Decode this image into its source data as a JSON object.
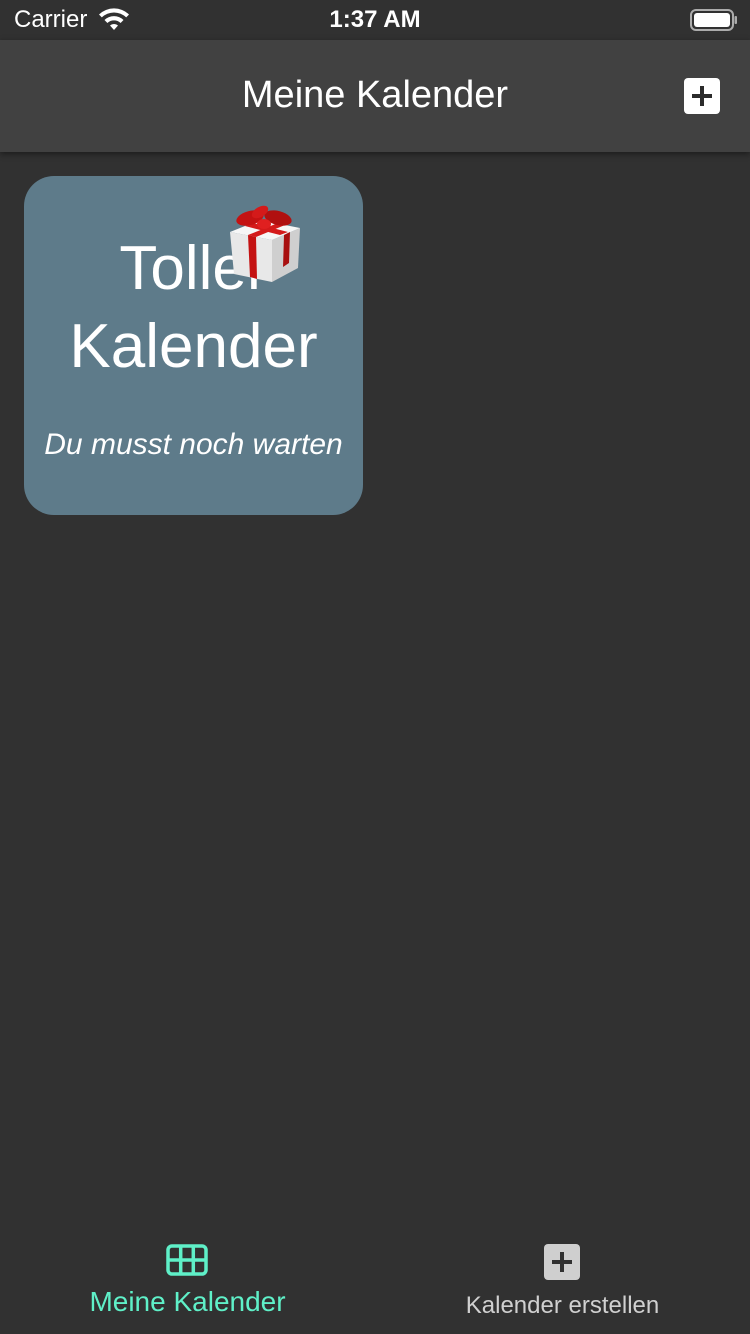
{
  "status_bar": {
    "carrier": "Carrier",
    "time": "1:37 AM",
    "wifi_icon": "wifi-icon",
    "battery_icon": "battery-icon"
  },
  "nav_bar": {
    "title": "Meine Kalender",
    "add_icon": "plus-icon"
  },
  "calendars": [
    {
      "title": "Toller Kalender",
      "subtitle": "Du musst noch warten",
      "icon": "gift-icon",
      "color": "#5e7b8a"
    }
  ],
  "tab_bar": {
    "items": [
      {
        "label": "Meine Kalender",
        "icon": "grid-icon",
        "active": true
      },
      {
        "label": "Kalender erstellen",
        "icon": "plus-box-icon",
        "active": false
      }
    ],
    "active_color": "#5ff0c8"
  },
  "colors": {
    "background": "#313131",
    "nav_background": "#414141"
  }
}
